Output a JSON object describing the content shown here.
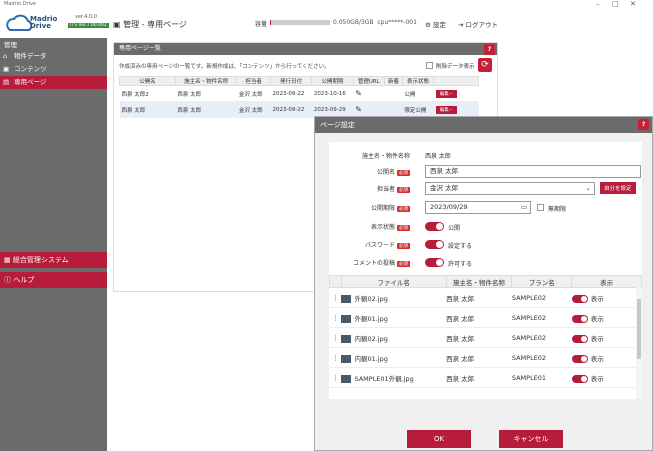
{
  "app": {
    "window_title": "Madrio Drive",
    "brand": "Madrio Drive",
    "version": "ver.4.0.0",
    "version_badge": "ITS Ver.7.00.002"
  },
  "header": {
    "title": "管理 - 専用ページ",
    "capacity_label": "容量",
    "capacity_fraction": 0.016,
    "capacity_text": "0.050GB/3GB",
    "cpu_text": "cpu*****-001",
    "settings": "設定",
    "logout": "ログアウト"
  },
  "sidebar": {
    "section": "管理",
    "items": [
      {
        "label": "物件データ",
        "icon": "home-icon"
      },
      {
        "label": "コンテンツ",
        "icon": "image-icon"
      },
      {
        "label": "専用ページ",
        "icon": "page-icon"
      }
    ],
    "system": "総合管理システム",
    "help": "ヘルプ"
  },
  "panel": {
    "title": "専用ページ一覧",
    "help": "?",
    "description": "作成済みの専用ページの一覧です。新規作成は、「コンテンツ」から行ってください。",
    "show_deleted": "削除データ表示",
    "columns": [
      "公開名",
      "施主名・物件名称",
      "担当者",
      "発行日付",
      "公開期限",
      "管理URL",
      "新着",
      "表示状態",
      ""
    ],
    "rows": [
      {
        "public": "西泉 太郎2",
        "owner": "西泉 太郎",
        "staff": "金沢 太郎",
        "issued": "2023-09-22",
        "expires": "2023-10-16",
        "state": "公開",
        "edit": "編集・"
      },
      {
        "public": "西泉 太郎",
        "owner": "西泉 太郎",
        "staff": "金沢 太郎",
        "issued": "2023-09-22",
        "expires": "2023-09-29",
        "state": "限定公開",
        "edit": "編集・"
      }
    ]
  },
  "modal": {
    "title": "ページ設定",
    "help": "?",
    "owner_label": "施主名・物件名称",
    "owner_value": "西泉 太郎",
    "public_label": "公開名",
    "public_value": "西泉 太郎",
    "staff_label": "担当者",
    "staff_value": "金沢 太郎",
    "self_button": "自分を設定",
    "expiry_label": "公開期限",
    "expiry_value": "2023/09/29",
    "unlimited": "無期限",
    "state_label": "表示状態",
    "state_value": "公開",
    "password_label": "パスワード",
    "password_value": "設定する",
    "comment_label": "コメントの投稿",
    "comment_value": "許可する",
    "required": "必須",
    "file_columns": [
      "ファイル名",
      "施主名・物件名称",
      "プラン名",
      "表示"
    ],
    "files": [
      {
        "name": "外観02.jpg",
        "owner": "西泉 太郎",
        "plan": "SAMPLE02",
        "show": "表示"
      },
      {
        "name": "外観01.jpg",
        "owner": "西泉 太郎",
        "plan": "SAMPLE02",
        "show": "表示"
      },
      {
        "name": "内観02.jpg",
        "owner": "西泉 太郎",
        "plan": "SAMPLE02",
        "show": "表示"
      },
      {
        "name": "内観01.jpg",
        "owner": "西泉 太郎",
        "plan": "SAMPLE02",
        "show": "表示"
      },
      {
        "name": "SAMPLE01外観.jpg",
        "owner": "西泉 太郎",
        "plan": "SAMPLE01",
        "show": "表示"
      }
    ],
    "ok": "OK",
    "cancel": "キャンセル"
  }
}
